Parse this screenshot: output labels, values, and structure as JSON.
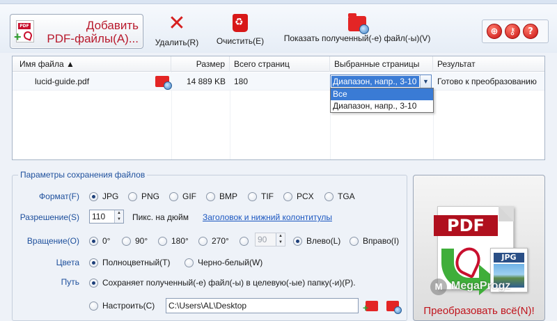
{
  "toolbar": {
    "add_label_1": "Добавить",
    "add_label_2": "PDF-файлы(A)...",
    "delete_label": "Удалить(R)",
    "clear_label": "Очистить(E)",
    "show_label": "Показать полученный(-е) файл(-ы)(V)"
  },
  "file_list": {
    "headers": {
      "name": "Имя файла ▲",
      "size": "Размер",
      "pages": "Всего страниц",
      "selected": "Выбранные страницы",
      "result": "Результат"
    },
    "rows": [
      {
        "name": "lucid-guide.pdf",
        "size": "14 889 KB",
        "pages": "180",
        "selected": "Диапазон, напр., 3-10",
        "result": "Готово к преобразованию"
      }
    ],
    "dropdown_options": [
      "Все",
      "Диапазон, напр., 3-10"
    ],
    "dropdown_selected_index": 0
  },
  "settings": {
    "legend": "Параметры сохранения файлов",
    "format": {
      "label": "Формат(F)",
      "options": [
        "JPG",
        "PNG",
        "GIF",
        "BMP",
        "TIF",
        "PCX",
        "TGA"
      ],
      "selected": "JPG"
    },
    "resolution": {
      "label": "Разрешение(S)",
      "value": "110",
      "unit": "Пикс. на дюйм",
      "link": "Заголовок и нижний колонтитулы"
    },
    "rotation": {
      "label": "Вращение(O)",
      "options": [
        "0°",
        "90°",
        "180°",
        "270°"
      ],
      "selected": "0°",
      "custom_value": "90",
      "direction_options": [
        "Влево(L)",
        "Вправо(I)"
      ],
      "direction_selected": "Влево(L)"
    },
    "color": {
      "label": "Цвета",
      "options": [
        "Полноцветный(T)",
        "Черно-белый(W)"
      ],
      "selected": "Полноцветный(T)"
    },
    "path": {
      "label": "Путь",
      "option_target": "Сохраняет полученный(-е) файл(-ы) в целевую(-ые) папку(-и)(P).",
      "option_custom": "Настроить(C)",
      "selected": "target",
      "custom_path": "C:\\Users\\AL\\Desktop"
    }
  },
  "convert": {
    "pdf_badge": "PDF",
    "jpg_badge": "JPG",
    "label": "Преобразовать всё(N)!"
  },
  "watermark": {
    "text": "MegaProgz"
  },
  "colors": {
    "accent_red": "#c0141c",
    "label_blue": "#1d4f9c",
    "selection_blue": "#3a7bd5",
    "arrow_green": "#3fae3a"
  }
}
